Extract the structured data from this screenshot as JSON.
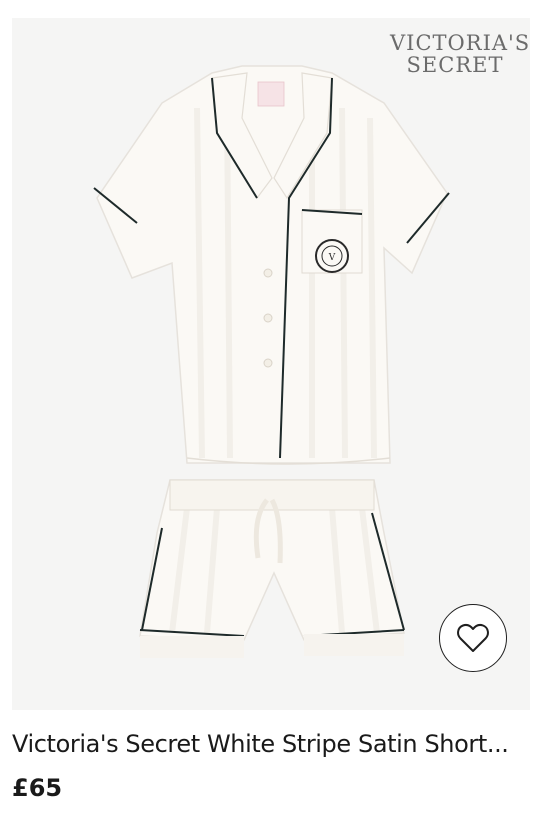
{
  "product": {
    "brand_line1": "VICTORIA'S",
    "brand_line2": "SECRET",
    "title": "Victoria's Secret White Stripe Satin Short...",
    "price": "£65",
    "wishlist_icon": "heart-outline-icon",
    "colors": {
      "image_background": "#f5f5f4",
      "garment": "#fbf9f5",
      "piping": "#1e2a2a",
      "text": "#1a1a1a"
    }
  }
}
